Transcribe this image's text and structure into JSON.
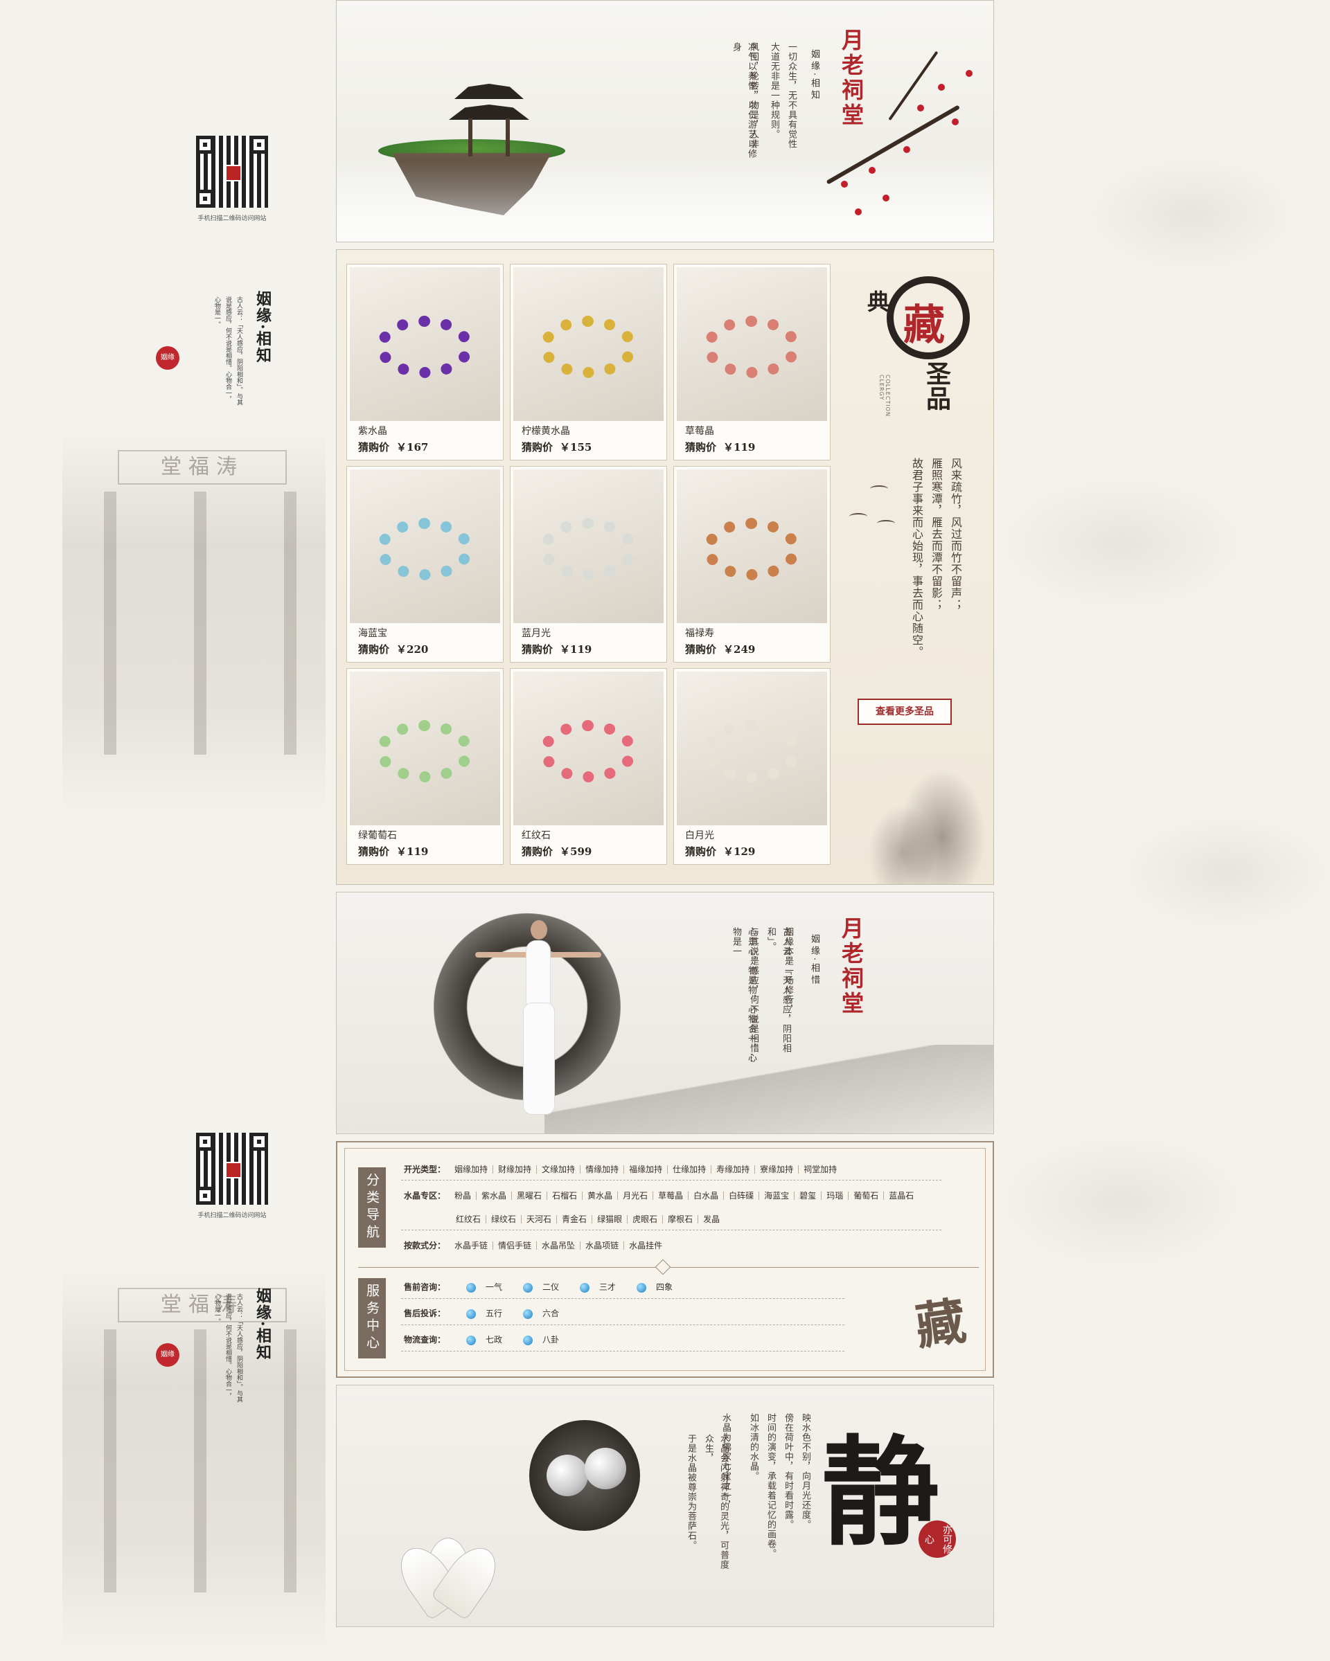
{
  "sidebar": {
    "qr_caption": "手机扫描二维码访问网站",
    "poem_title": "姻缘·相知",
    "poem_lines": "古人云：「天人感应，阴阳相和」。与其说是感应，何不说是相惜。心物合一，心物是一。",
    "seal_text": "姻缘"
  },
  "banner1": {
    "brand": "月老祠堂",
    "subtitle": "姻缘·相知",
    "text_col1": "一切众生，无不具有觉性",
    "text_col2": "大道无非是一种规则。",
    "text_col3": "风回，轮转，物是，人非",
    "text_col4": "冲气以养性，以仁游艺以修身"
  },
  "products": {
    "items": [
      {
        "name": "紫水晶",
        "price_label": "猜购价",
        "price": "￥167",
        "color": "#6b2fa8"
      },
      {
        "name": "柠檬黄水晶",
        "price_label": "猜购价",
        "price": "￥155",
        "color": "#d8b23a"
      },
      {
        "name": "草莓晶",
        "price_label": "猜购价",
        "price": "￥119",
        "color": "#d97f73"
      },
      {
        "name": "海蓝宝",
        "price_label": "猜购价",
        "price": "￥220",
        "color": "#86c5d8"
      },
      {
        "name": "蓝月光",
        "price_label": "猜购价",
        "price": "￥119",
        "color": "#d8dbd6"
      },
      {
        "name": "福禄寿",
        "price_label": "猜购价",
        "price": "￥249",
        "color": "#c9804b"
      },
      {
        "name": "绿葡萄石",
        "price_label": "猜购价",
        "price": "￥119",
        "color": "#9fcf8b"
      },
      {
        "name": "红纹石",
        "price_label": "猜购价",
        "price": "￥599",
        "color": "#e56a7a"
      },
      {
        "name": "白月光",
        "price_label": "猜购价",
        "price": "￥129",
        "color": "#e8e2d6"
      }
    ],
    "collect_big": "藏",
    "collect_small1": "典",
    "collect_small2": "圣品",
    "collect_en": "COLLECTION CLERGY",
    "poem_col1": "风来疏竹，风过而竹不留声；",
    "poem_col2": "雁照寒潭，雁去而潭不留影；",
    "poem_col3": "故君子事来而心始现，事去而心随空。",
    "more_button": "查看更多圣品"
  },
  "banner2": {
    "brand": "月老祠堂",
    "subtitle": "姻缘·相惜",
    "text_col1": "姻缘本是一场修行，",
    "text_col2": "古人云：「天人感应，阴阳相和」。",
    "text_col3": "与其说是感应，何不说是相惜…",
    "text_col4": "心是心，物是物，心物合一，心物是一"
  },
  "nav": {
    "tag_category": "分类导航",
    "tag_service": "服务中心",
    "row1_label": "开光类型：",
    "row1_items": [
      "姻缘加持",
      "财缘加持",
      "文缘加持",
      "情缘加持",
      "福缘加持",
      "仕缘加持",
      "寿缘加持",
      "寮缘加持",
      "祠堂加持"
    ],
    "row2_label": "水晶专区：",
    "row2_items": [
      "粉晶",
      "紫水晶",
      "黑曜石",
      "石榴石",
      "黄水晶",
      "月光石",
      "草莓晶",
      "白水晶",
      "白砗磲",
      "海蓝宝",
      "碧玺",
      "玛瑙",
      "葡萄石",
      "蓝晶石"
    ],
    "row3_items": [
      "红纹石",
      "绿纹石",
      "天河石",
      "青金石",
      "绿猫眼",
      "虎眼石",
      "摩根石",
      "发晶"
    ],
    "row4_label": "按款式分：",
    "row4_items": [
      "水晶手链",
      "情侣手链",
      "水晶吊坠",
      "水晶项链",
      "水晶挂件"
    ],
    "svc1_label": "售前咨询：",
    "svc1_items": [
      "一气",
      "二仪",
      "三才",
      "四象"
    ],
    "svc2_label": "售后投诉：",
    "svc2_items": [
      "五行",
      "六合"
    ],
    "svc3_label": "物流查询：",
    "svc3_items": [
      "七政",
      "八卦"
    ],
    "cang": "藏"
  },
  "banner3": {
    "jing": "静",
    "seal": "亦可修心",
    "col1": "映水色不别，向月光还度。",
    "col2": "傍在荷叶中，有时看时露。",
    "col3": "时间的演变，承载着记忆的画卷。",
    "col4": "如冰清的水晶。",
    "col5": "水晶为佛家七宝之一，",
    "col6": "水晶会闪射神奇的灵光，可普度众生，",
    "col7": "于是水晶被尊崇为菩萨石。"
  }
}
